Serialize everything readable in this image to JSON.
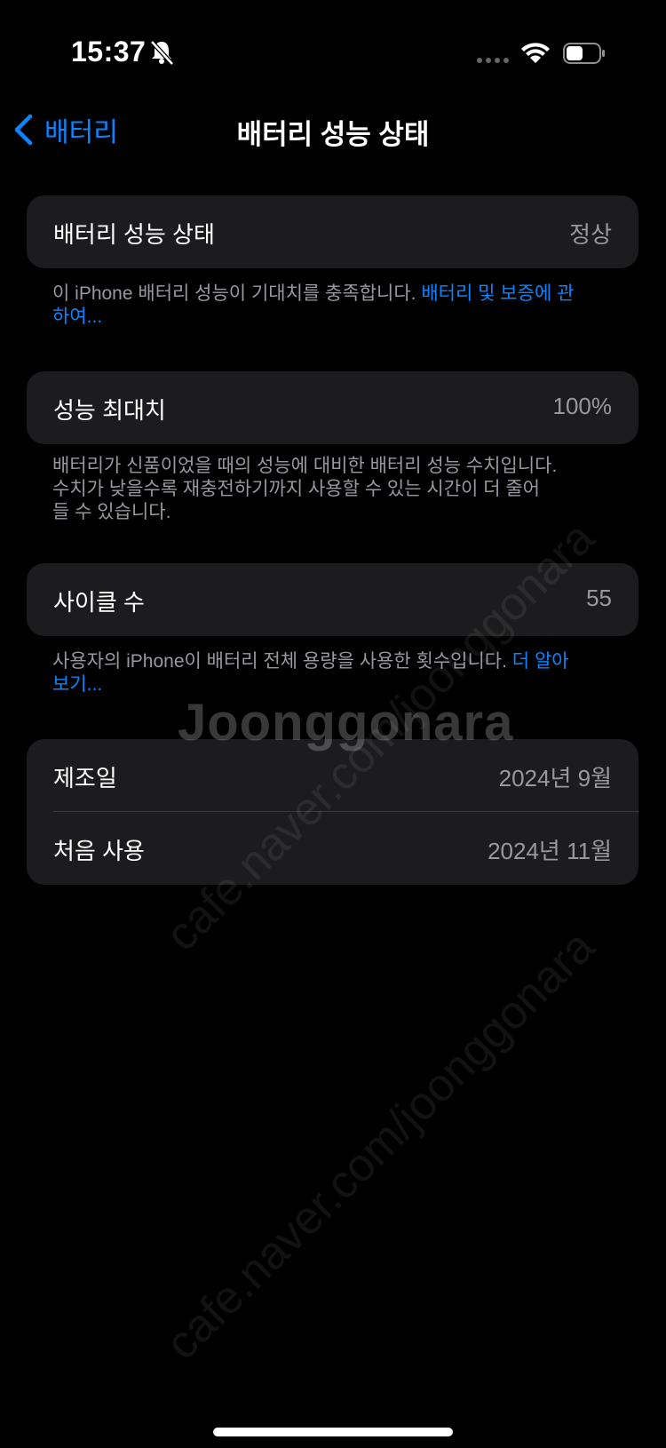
{
  "status_bar": {
    "time": "15:37"
  },
  "nav": {
    "back_label": "배터리",
    "title": "배터리 성능 상태"
  },
  "health_section": {
    "label": "배터리 성능 상태",
    "value": "정상",
    "footnote_text": "이 iPhone 배터리 성능이 기대치를 충족합니다. ",
    "footnote_link": "배터리 및 보증에 관하여..."
  },
  "capacity_section": {
    "label": "성능 최대치",
    "value": "100%",
    "footnote_line1": "배터리가 신품이었을 때의 성능에 대비한 배터리 성능 수치입니다.",
    "footnote_line2": "수치가 낮을수록 재충전하기까지 사용할 수 있는 시간이 더 줄어",
    "footnote_line3": "들 수 있습니다."
  },
  "cycle_section": {
    "label": "사이클 수",
    "value": "55",
    "footnote_text": "사용자의 iPhone이 배터리 전체 용량을 사용한 횟수입니다. ",
    "footnote_link": "더 알아보기..."
  },
  "dates_section": {
    "manufacture_label": "제조일",
    "manufacture_value": "2024년 9월",
    "first_use_label": "처음 사용",
    "first_use_value": "2024년 11월"
  },
  "watermark": {
    "url": "cafe.naver.com/joonggonara",
    "logo": "Joonggonara"
  },
  "colors": {
    "accent": "#0a84ff",
    "card": "#1c1c1e",
    "secondary_text": "#98989f"
  }
}
